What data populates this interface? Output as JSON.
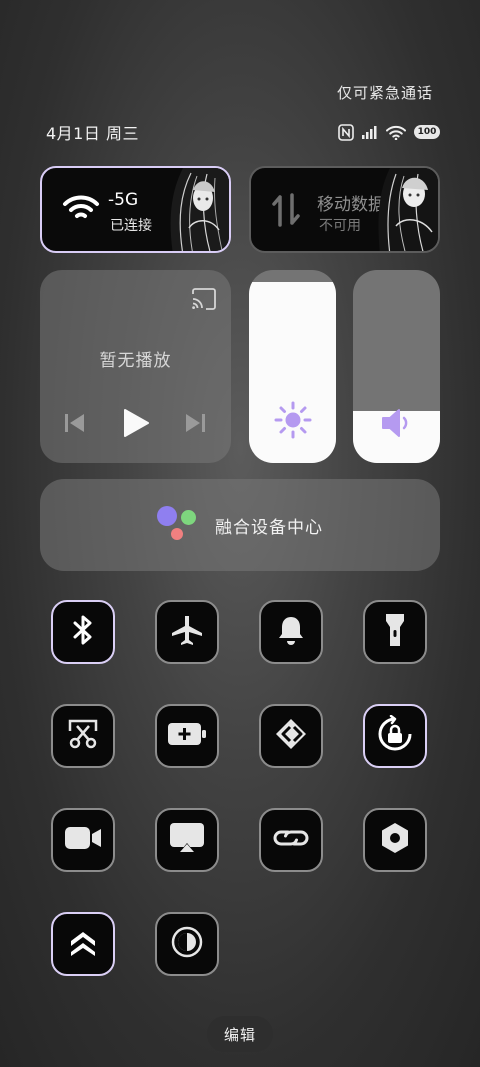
{
  "status": {
    "emergency_text": "仅可紧急通话",
    "date": "4月1日 周三",
    "battery": "100",
    "icons": [
      "nfc-icon",
      "signal-icon",
      "wifi-icon",
      "battery-icon"
    ]
  },
  "wifi_card": {
    "title": "-5G",
    "subtitle": "已连接",
    "icon": "wifi-icon",
    "active": true
  },
  "data_card": {
    "title": "移动数据",
    "subtitle": "不可用",
    "icon": "mobile-data-icon",
    "active": false
  },
  "media": {
    "now_playing": "暂无播放",
    "icons": [
      "cast-icon",
      "previous-icon",
      "play-icon",
      "next-icon"
    ]
  },
  "brightness": {
    "level": 0.94,
    "icon": "brightness-icon"
  },
  "volume": {
    "level": 0.27,
    "icon": "volume-icon"
  },
  "fusion": {
    "label": "融合设备中心",
    "dot_colors": [
      "#8f7ff0",
      "#7ed67e",
      "#f08080"
    ]
  },
  "toggles": [
    {
      "name": "bluetooth",
      "icon": "bluetooth-icon",
      "on": true
    },
    {
      "name": "airplane-mode",
      "icon": "airplane-icon",
      "on": false
    },
    {
      "name": "ringer",
      "icon": "bell-icon",
      "on": false
    },
    {
      "name": "flashlight",
      "icon": "flashlight-icon",
      "on": false
    },
    {
      "name": "screenshot",
      "icon": "screenshot-scissors-icon",
      "on": false
    },
    {
      "name": "power-saving",
      "icon": "battery-plus-icon",
      "on": false
    },
    {
      "name": "share",
      "icon": "share-arrows-icon",
      "on": false
    },
    {
      "name": "rotation-lock",
      "icon": "rotation-lock-icon",
      "on": true
    },
    {
      "name": "screen-record",
      "icon": "video-camera-icon",
      "on": false
    },
    {
      "name": "screen-cast",
      "icon": "screen-cast-icon",
      "on": false
    },
    {
      "name": "hotspot-link",
      "icon": "link-icon",
      "on": false
    },
    {
      "name": "settings",
      "icon": "hexagon-nut-icon",
      "on": false
    },
    {
      "name": "performance",
      "icon": "double-chevron-up-icon",
      "on": true
    },
    {
      "name": "dark-mode",
      "icon": "contrast-icon",
      "on": false
    }
  ],
  "edit_label": "编辑",
  "colors": {
    "accent": "#d9cdf6",
    "icon_accent": "#b59af0",
    "tile_bg": "#080808"
  }
}
